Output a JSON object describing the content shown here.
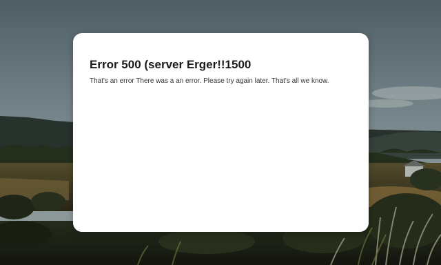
{
  "background": {
    "description_icon": "landscape-photo"
  },
  "dialog": {
    "title": "Error 500 (server Erger!!1500",
    "message": "That's an error There was a an error. Please try again later. That's all we know."
  },
  "colors": {
    "sky_top": "#5e7077",
    "sky_bottom": "#93a3a6",
    "hills": "#2f3a33",
    "field": "#6b5a33",
    "foreground": "#1f2418",
    "dialog_bg": "#ffffff",
    "title_text": "#1b1b1b",
    "body_text": "#333333"
  }
}
